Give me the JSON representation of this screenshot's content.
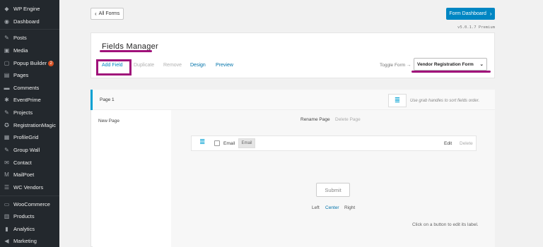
{
  "sidebar": {
    "items": [
      {
        "label": "WP Engine",
        "icon": "wpengine-icon"
      },
      {
        "label": "Dashboard",
        "icon": "dashboard-icon"
      },
      {
        "label": "Posts",
        "icon": "pin-icon"
      },
      {
        "label": "Media",
        "icon": "media-icon"
      },
      {
        "label": "Popup Builder",
        "icon": "popup-icon",
        "badge": "2"
      },
      {
        "label": "Pages",
        "icon": "pages-icon"
      },
      {
        "label": "Comments",
        "icon": "comments-icon"
      },
      {
        "label": "EventPrime",
        "icon": "event-icon"
      },
      {
        "label": "Projects",
        "icon": "pin-icon"
      },
      {
        "label": "RegistrationMagic",
        "icon": "registration-icon"
      },
      {
        "label": "ProfileGrid",
        "icon": "profile-icon"
      },
      {
        "label": "Group Wall",
        "icon": "pin-icon"
      },
      {
        "label": "Contact",
        "icon": "mail-icon"
      },
      {
        "label": "MailPoet",
        "icon": "mailpoet-icon"
      },
      {
        "label": "WC Vendors",
        "icon": "vendors-icon"
      },
      {
        "label": "WooCommerce",
        "icon": "woo-icon"
      },
      {
        "label": "Products",
        "icon": "products-icon"
      },
      {
        "label": "Analytics",
        "icon": "analytics-icon"
      },
      {
        "label": "Marketing",
        "icon": "marketing-icon"
      }
    ]
  },
  "toolbar": {
    "all_forms_label": "All Forms",
    "form_dashboard_label": "Form Dashboard",
    "version": "v5.0.1.7 Premium"
  },
  "fields_manager": {
    "title": "Fields Manager",
    "tabs": {
      "add_field": "Add Field",
      "duplicate": "Duplicate",
      "remove": "Remove",
      "design": "Design",
      "preview": "Preview"
    },
    "toggle_label": "Toggle Form →",
    "selected_form": "Vendor Registration Form"
  },
  "page_panel": {
    "page_name": "Page 1",
    "grab_hint": "Use grab handles to sort fields order.",
    "new_page": "New Page",
    "rename_page": "Rename Page",
    "delete_page": "Delete Page",
    "field": {
      "name": "Email",
      "type": "Email",
      "edit": "Edit",
      "delete": "Delete"
    },
    "submit_label": "Submit",
    "align": {
      "left": "Left",
      "center": "Center",
      "right": "Right"
    },
    "click_hint": "Click on a button to edit its label."
  },
  "colors": {
    "sidebar_bg": "#23282d",
    "accent_blue": "#0086c3",
    "highlight_magenta": "#a0127a",
    "badge": "#d54e21"
  }
}
